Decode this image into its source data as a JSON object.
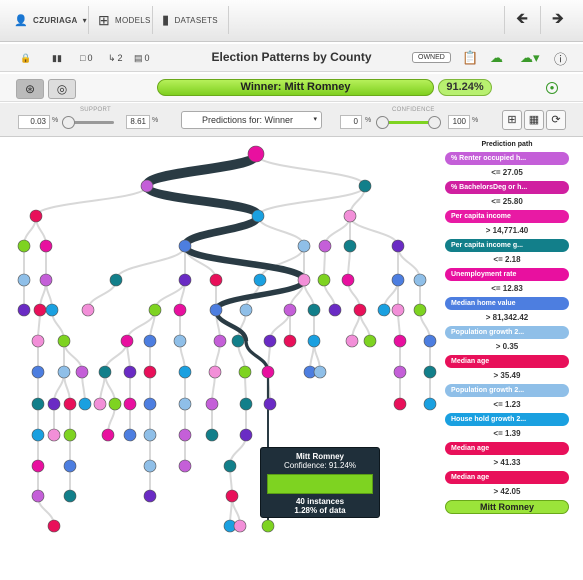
{
  "nav": {
    "user": "CZURIAGA",
    "models": "MODELS",
    "datasets": "DATASETS"
  },
  "toolbar": {
    "title": "Election Patterns by County",
    "owned": "OWNED",
    "comments": "0",
    "forks": "2",
    "preds": "0"
  },
  "result": {
    "winner": "Winner: Mitt Romney",
    "confidence": "91.24%"
  },
  "filters": {
    "support_label": "SUPPORT",
    "support_min": "0.03",
    "support_max": "8.61",
    "predictions_for": "Predictions for: Winner",
    "confidence_label": "CONFIDENCE",
    "conf_min": "0",
    "conf_max": "100",
    "unit": "%"
  },
  "tooltip": {
    "title": "Mitt Romney",
    "confidence": "Confidence: 91.24%",
    "instances": "40 instances",
    "data": "1.28% of data"
  },
  "path": {
    "title": "Prediction path",
    "steps": [
      {
        "field": "% Renter occupied h...",
        "cond": "<= 27.05",
        "color": "#c45fd8"
      },
      {
        "field": "% BachelorsDeg or h...",
        "cond": "<= 25.80",
        "color": "#d01fa0"
      },
      {
        "field": "Per capita income",
        "cond": "> 14,771.40",
        "color": "#e81aa4"
      },
      {
        "field": "Per capita income g...",
        "cond": "<= 2.18",
        "color": "#127f8a"
      },
      {
        "field": "Unemployment rate",
        "cond": "<= 12.83",
        "color": "#e8109f"
      },
      {
        "field": "Median home value",
        "cond": "> 81,342.42",
        "color": "#4d7ee0"
      },
      {
        "field": "Population growth 2...",
        "cond": "> 0.35",
        "color": "#8fbfe8"
      },
      {
        "field": "Median age",
        "cond": "> 35.49",
        "color": "#e8105a"
      },
      {
        "field": "Population growth 2...",
        "cond": "<= 1.23",
        "color": "#8fbfe8"
      },
      {
        "field": "House hold growth 2...",
        "cond": "<= 1.39",
        "color": "#1aa0e0"
      },
      {
        "field": "Median age",
        "cond": "> 41.33",
        "color": "#e8105a"
      },
      {
        "field": "Median age",
        "cond": "> 42.05",
        "color": "#e8105a"
      }
    ],
    "final": "Mitt Romney"
  }
}
